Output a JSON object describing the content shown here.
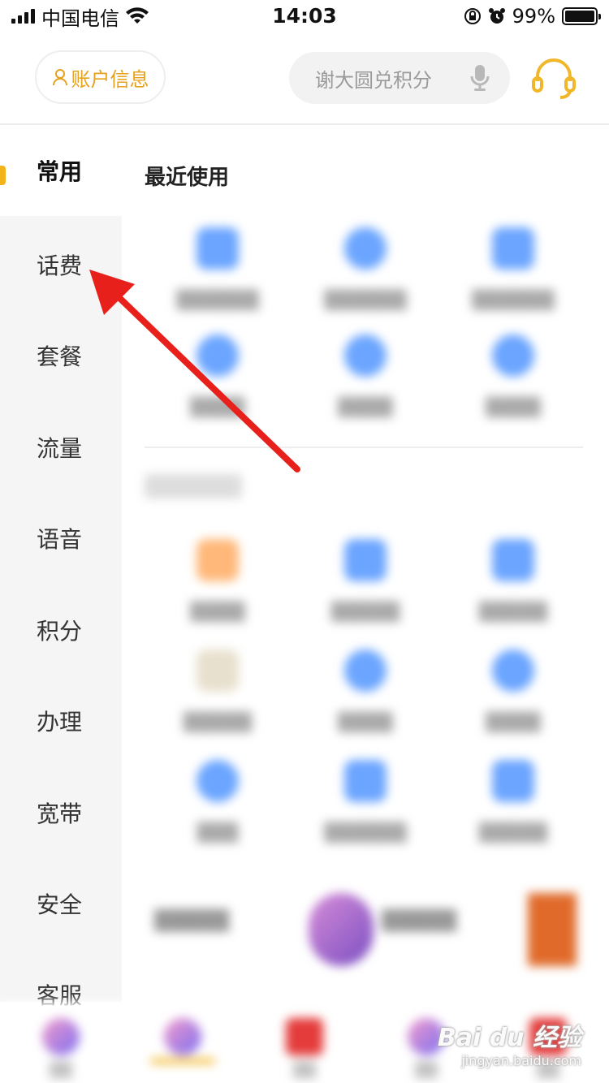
{
  "status_bar": {
    "carrier": "中国电信",
    "time": "14:03",
    "battery_percent": "99%"
  },
  "header": {
    "account_label": "账户信息",
    "search_placeholder": "谢大圆兑积分",
    "colors": {
      "accent": "#e7a21d",
      "marker": "#f2b31b"
    }
  },
  "sidebar": {
    "items": [
      {
        "label": "常用",
        "active": true
      },
      {
        "label": "话费"
      },
      {
        "label": "套餐"
      },
      {
        "label": "流量"
      },
      {
        "label": "语音"
      },
      {
        "label": "积分"
      },
      {
        "label": "办理"
      },
      {
        "label": "宽带"
      },
      {
        "label": "安全"
      },
      {
        "label": "客服"
      }
    ]
  },
  "main": {
    "recent_title": "最近使用"
  },
  "watermark": {
    "brand": "Bai du 经验",
    "url": "jingyan.baidu.com"
  },
  "icons": [
    "person-icon",
    "microphone-icon",
    "headset-icon",
    "signal-icon",
    "wifi-icon",
    "lock-rotation-icon",
    "alarm-icon",
    "battery-icon",
    "red-arrow"
  ]
}
